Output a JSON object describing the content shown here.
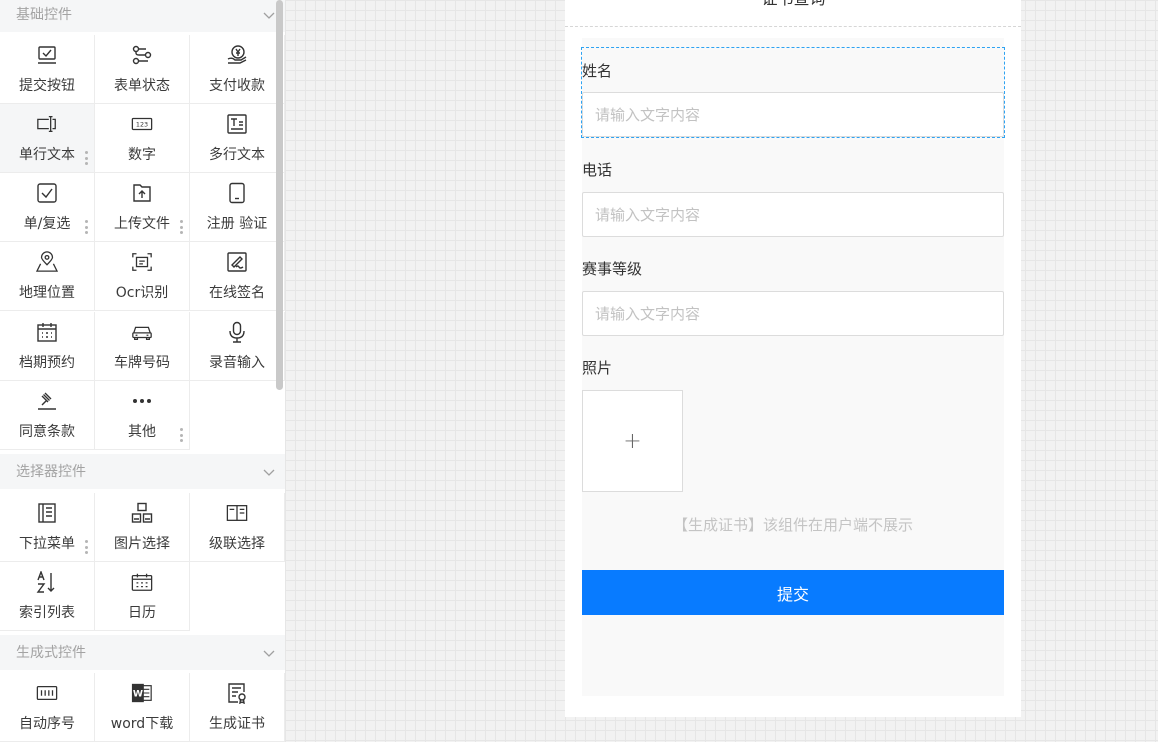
{
  "sidebar": {
    "groups": [
      {
        "title": "基础控件",
        "items": [
          {
            "label": "提交按钮",
            "icon": "submit-icon"
          },
          {
            "label": "表单状态",
            "icon": "form-status-icon"
          },
          {
            "label": "支付收款",
            "icon": "payment-icon"
          },
          {
            "label": "单行文本",
            "icon": "single-line-text-icon"
          },
          {
            "label": "数字",
            "icon": "number-icon"
          },
          {
            "label": "多行文本",
            "icon": "multi-line-text-icon"
          },
          {
            "label": "单/复选",
            "icon": "checkbox-icon"
          },
          {
            "label": "上传文件",
            "icon": "upload-file-icon"
          },
          {
            "label": "注册 验证",
            "icon": "phone-verify-icon"
          },
          {
            "label": "地理位置",
            "icon": "map-location-icon"
          },
          {
            "label": "Ocr识别",
            "icon": "ocr-scan-icon"
          },
          {
            "label": "在线签名",
            "icon": "signature-icon"
          },
          {
            "label": "档期预约",
            "icon": "calendar-schedule-icon"
          },
          {
            "label": "车牌号码",
            "icon": "car-icon"
          },
          {
            "label": "录音输入",
            "icon": "microphone-icon"
          },
          {
            "label": "同意条款",
            "icon": "gavel-icon"
          },
          {
            "label": "其他",
            "icon": "more-icon"
          }
        ]
      },
      {
        "title": "选择器控件",
        "items": [
          {
            "label": "下拉菜单",
            "icon": "dropdown-list-icon"
          },
          {
            "label": "图片选择",
            "icon": "image-select-icon"
          },
          {
            "label": "级联选择",
            "icon": "cascade-select-icon"
          },
          {
            "label": "索引列表",
            "icon": "sort-az-icon"
          },
          {
            "label": "日历",
            "icon": "calendar-icon"
          }
        ]
      },
      {
        "title": "生成式控件",
        "items": [
          {
            "label": "自动序号",
            "icon": "auto-number-icon"
          },
          {
            "label": "word下载",
            "icon": "word-icon"
          },
          {
            "label": "生成证书",
            "icon": "certificate-icon"
          }
        ]
      }
    ]
  },
  "form": {
    "title": "证书查询",
    "fields": [
      {
        "label": "姓名",
        "placeholder": "请输入文字内容"
      },
      {
        "label": "电话",
        "placeholder": "请输入文字内容"
      },
      {
        "label": "赛事等级",
        "placeholder": "请输入文字内容"
      }
    ],
    "photo_label": "照片",
    "upload_plus": "+",
    "hint": "【生成证书】该组件在用户端不展示",
    "submit_label": "提交"
  },
  "colors": {
    "accent": "#087bff",
    "selection": "#2ea3f2"
  }
}
